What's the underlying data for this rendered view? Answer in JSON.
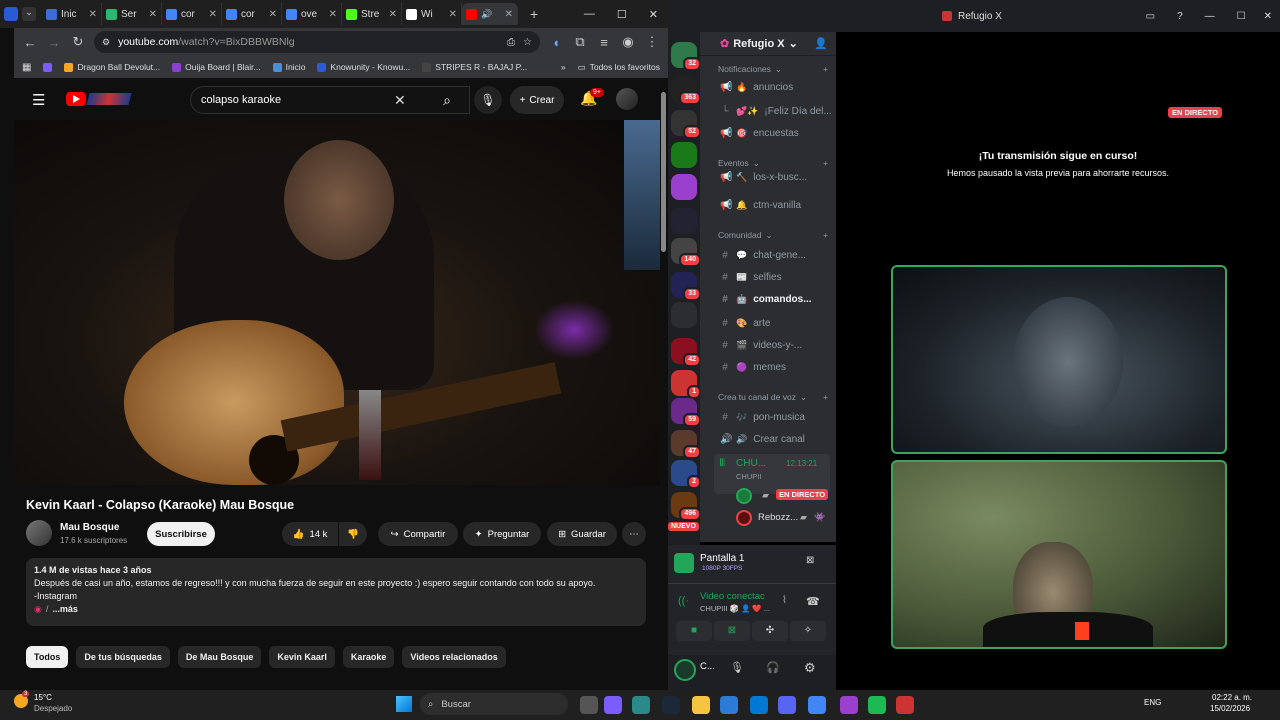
{
  "browser": {
    "tabs": [
      {
        "label": "Inic",
        "color": "#3f6bd6"
      },
      {
        "label": "Ser",
        "color": "#2bb673"
      },
      {
        "label": "cor",
        "color": "#4285f4"
      },
      {
        "label": "cor",
        "color": "#4285f4"
      },
      {
        "label": "ove",
        "color": "#4285f4"
      },
      {
        "label": "Stre",
        "color": "#53fc18"
      },
      {
        "label": "Wi",
        "color": "#ffffff"
      }
    ],
    "url_host": "youtube.com",
    "url_path": "/watch?v=BixDBBWBNlg",
    "bookmarks": [
      "Dragon Ball Devolut...",
      "Ouija Board | Blair...",
      "Inicio",
      "Knowunity - Knowu...",
      "STRIPES R - BAJAJ P..."
    ],
    "all_bookmarks": "Todos los favoritos"
  },
  "youtube": {
    "search_value": "colapso karaoke",
    "create_label": "Crear",
    "notif_badge": "9+",
    "video_title": "Kevin Kaarl - Colapso (Karaoke) Mau Bosque",
    "channel_name": "Mau Bosque",
    "channel_subs": "17.6 k suscriptores",
    "subscribe_label": "Suscribirse",
    "likes": "14 k",
    "share_label": "Compartir",
    "ask_label": "Preguntar",
    "save_label": "Guardar",
    "desc_stats": "1.4 M de vistas  hace 3 años",
    "desc_line1": "Después de casi un año, estamos de regreso!!! y con mucha fuerza de seguir en este proyecto :) espero seguir contando con todo su apoyo.",
    "desc_line2": "-Instagram",
    "desc_more": "...más",
    "chips": [
      "Todos",
      "De tus búsquedas",
      "De Mau Bosque",
      "Kevin Kaarl",
      "Karaoke",
      "Videos relacionados"
    ]
  },
  "discord": {
    "window_title": "Refugio X",
    "server_name": "Refugio X",
    "server_badges": [
      "32",
      "363",
      "52",
      "",
      "",
      "",
      "140",
      "33",
      "",
      "42",
      "1",
      "59",
      "47",
      "2",
      "496"
    ],
    "new_label": "NUEVO",
    "categories": [
      "Notificaciones",
      "Eventos",
      "Comunidad",
      "Crea tu canal de voz"
    ],
    "channels": [
      {
        "name": "anuncios",
        "emoji": "🔥",
        "icon": "📢"
      },
      {
        "name": "¡Feliz Día del...",
        "emoji": "💕✨",
        "icon": "└"
      },
      {
        "name": "encuestas",
        "emoji": "🎯",
        "icon": "📢"
      },
      {
        "name": "los-x-busc...",
        "emoji": "🔨",
        "icon": "📢"
      },
      {
        "name": "ctm-vanilla",
        "emoji": "🔔",
        "icon": "📢"
      },
      {
        "name": "chat-gene...",
        "emoji": "💬",
        "icon": "#"
      },
      {
        "name": "selfies",
        "emoji": "📰",
        "icon": "#"
      },
      {
        "name": "comandos...",
        "emoji": "🤖",
        "icon": "#"
      },
      {
        "name": "arte",
        "emoji": "🎨",
        "icon": "#"
      },
      {
        "name": "videos-y-...",
        "emoji": "🎬",
        "icon": "#"
      },
      {
        "name": "memes",
        "emoji": "🟣",
        "icon": "#"
      },
      {
        "name": "pon-musica",
        "emoji": "🎶",
        "icon": "#"
      },
      {
        "name": "Crear canal",
        "emoji": "🔊",
        "icon": "🔊"
      }
    ],
    "voice_channel": "CHU...",
    "voice_time": "12:13:21",
    "voice_sub": "CHUPII",
    "live_label": "EN DIRECTO",
    "voice_user2": "Rebozz...",
    "screen_title": "Pantalla 1",
    "screen_sub": "1080P 30FPS",
    "video_status": "Video conectac",
    "video_status_sub": "CHUPIII 🎲 👤 ❤️ ...",
    "user_short": "C...",
    "stream_title": "¡Tu transmisión sigue en curso!",
    "stream_sub": "Hemos pausado la vista previa para ahorrarte recursos."
  },
  "taskbar": {
    "temp": "15°C",
    "weather": "Despejado",
    "search_label": "Buscar",
    "lang": "ENG",
    "time": "02:22 a. m.",
    "date": "15/02/2026"
  }
}
